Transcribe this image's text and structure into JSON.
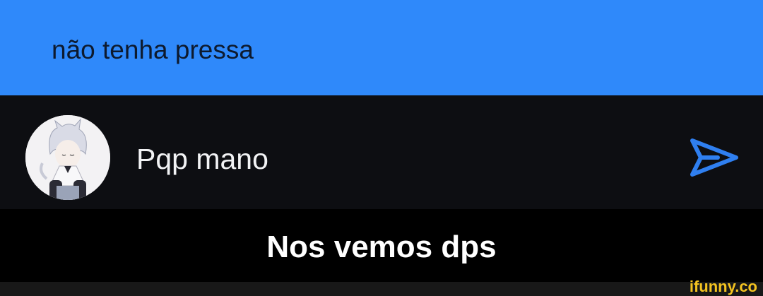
{
  "message": {
    "text": "não tenha pressa",
    "bubble_color": "#2f89fa"
  },
  "composer": {
    "avatar_icon": "anime-avatar-icon",
    "input_value": "Pqp mano",
    "send_icon": "send-icon",
    "send_color": "#2f7ff0"
  },
  "caption": {
    "text": "Nos vemos dps"
  },
  "watermark": {
    "text": "ifunny.co",
    "color": "#f4c320"
  }
}
